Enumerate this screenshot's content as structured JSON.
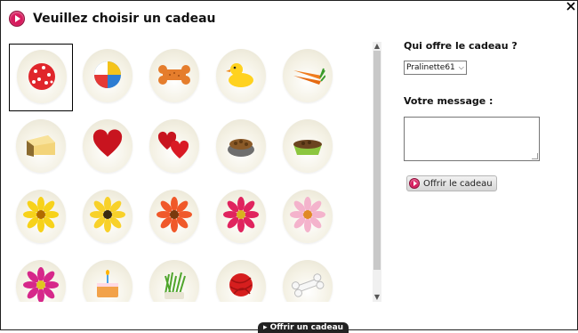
{
  "dialog": {
    "title": "Veuillez choisir un cadeau",
    "close_icon": "close-icon"
  },
  "gifts": [
    {
      "name": "red-ball",
      "selected": true
    },
    {
      "name": "beach-ball",
      "selected": false
    },
    {
      "name": "dog-bone-biscuit",
      "selected": false
    },
    {
      "name": "rubber-duck",
      "selected": false
    },
    {
      "name": "carrots",
      "selected": false
    },
    {
      "name": "cheese",
      "selected": false
    },
    {
      "name": "red-heart",
      "selected": false
    },
    {
      "name": "two-hearts",
      "selected": false
    },
    {
      "name": "pet-food-bowl",
      "selected": false
    },
    {
      "name": "green-food-bowl",
      "selected": false
    },
    {
      "name": "yellow-daisy",
      "selected": false
    },
    {
      "name": "yellow-gerbera",
      "selected": false
    },
    {
      "name": "orange-gerbera",
      "selected": false
    },
    {
      "name": "pink-red-gerbera",
      "selected": false
    },
    {
      "name": "pale-pink-flower",
      "selected": false
    },
    {
      "name": "magenta-flower",
      "selected": false
    },
    {
      "name": "birthday-cake",
      "selected": false
    },
    {
      "name": "cat-grass",
      "selected": false
    },
    {
      "name": "yarn-ball",
      "selected": false
    },
    {
      "name": "white-bone",
      "selected": false
    }
  ],
  "side": {
    "from_label": "Qui offre le cadeau ?",
    "from_value": "Pralinette61",
    "message_label": "Votre message :",
    "message_value": "",
    "submit_label": "Offrir le cadeau"
  },
  "footer": {
    "button_label": "Offrir un cadeau"
  }
}
